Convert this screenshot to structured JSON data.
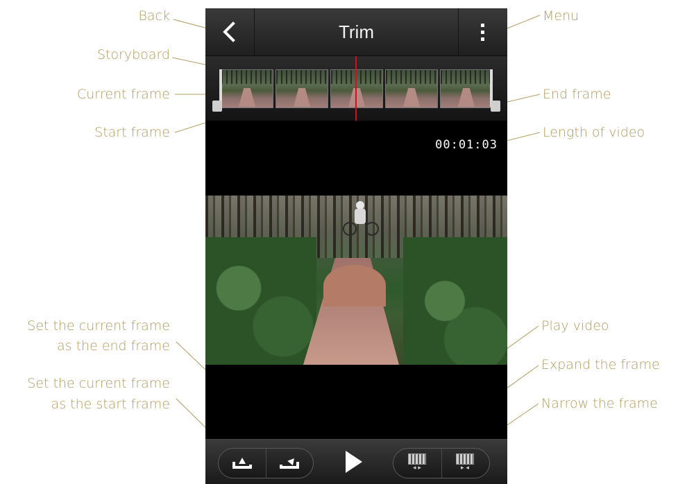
{
  "app": {
    "title": "Trim",
    "time_length": "00:01:03"
  },
  "annotations": {
    "back": "Back",
    "menu": "Menu",
    "storyboard": "Storyboard",
    "current_frame": "Current frame",
    "end_frame": "End frame",
    "start_frame": "Start frame",
    "length_of_video": "Length of video",
    "set_end_line1": "Set the current frame",
    "set_end_line2": "as the end frame",
    "set_start_line1": "Set the current frame",
    "set_start_line2": "as the start frame",
    "play_video": "Play video",
    "expand_frame": "Expand the frame",
    "narrow_frame": "Narrow the frame"
  },
  "icons": {
    "back": "chevron-left-icon",
    "menu": "overflow-menu-icon",
    "set_start": "set-start-frame-icon",
    "set_end": "set-end-frame-icon",
    "play": "play-icon",
    "expand": "expand-filmstrip-icon",
    "narrow": "narrow-filmstrip-icon"
  },
  "colors": {
    "annotation": "#b29b5b",
    "playhead": "#d0121b",
    "bar": "#2a2a2a"
  }
}
